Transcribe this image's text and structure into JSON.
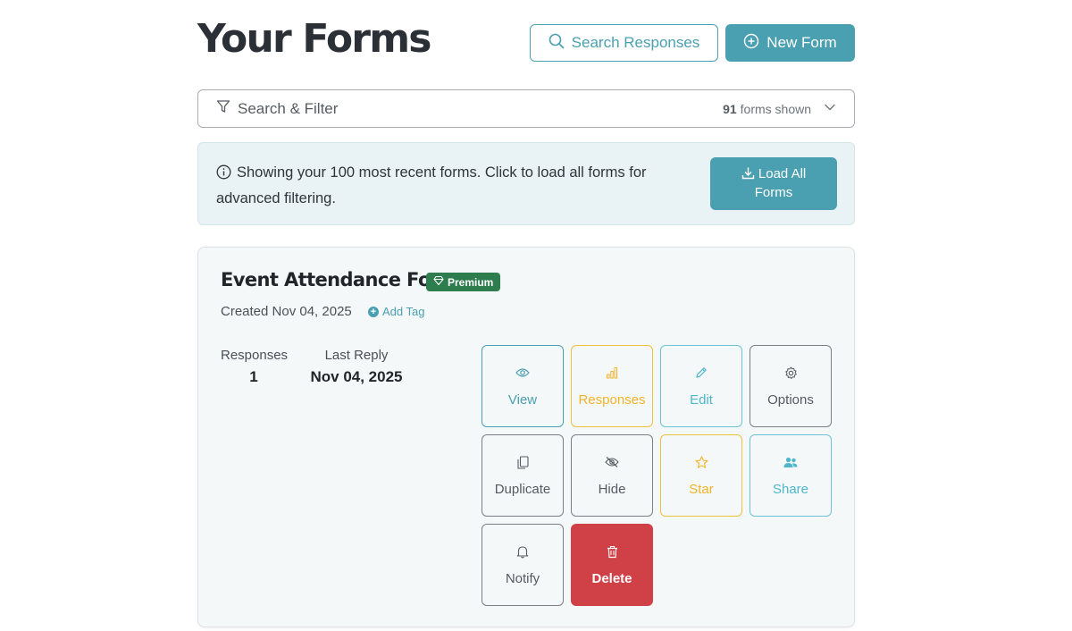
{
  "header": {
    "title": "Your Forms",
    "search_responses_label": "Search Responses",
    "new_form_label": "New Form"
  },
  "filter": {
    "label": "Search & Filter",
    "count": "91",
    "count_suffix": "forms shown"
  },
  "info": {
    "message": "Showing your 100 most recent forms. Click to load all forms for advanced filtering.",
    "load_all_label_line1": "Load All",
    "load_all_label_line2": "Forms"
  },
  "form": {
    "title": "Event Attendance Form",
    "badge": "Premium",
    "created": "Created Nov 04, 2025",
    "add_tag": "Add Tag",
    "responses_label": "Responses",
    "responses_value": "1",
    "last_reply_label": "Last Reply",
    "last_reply_value": "Nov 04, 2025",
    "actions": {
      "view": "View",
      "responses": "Responses",
      "edit": "Edit",
      "options": "Options",
      "duplicate": "Duplicate",
      "hide": "Hide",
      "star": "Star",
      "share": "Share",
      "notify": "Notify",
      "delete": "Delete"
    }
  },
  "colors": {
    "primary": "#4a9fb0",
    "premium": "#2e7d4f",
    "warning": "#f0b429",
    "info": "#4fb6cc",
    "danger": "#cf4146"
  }
}
